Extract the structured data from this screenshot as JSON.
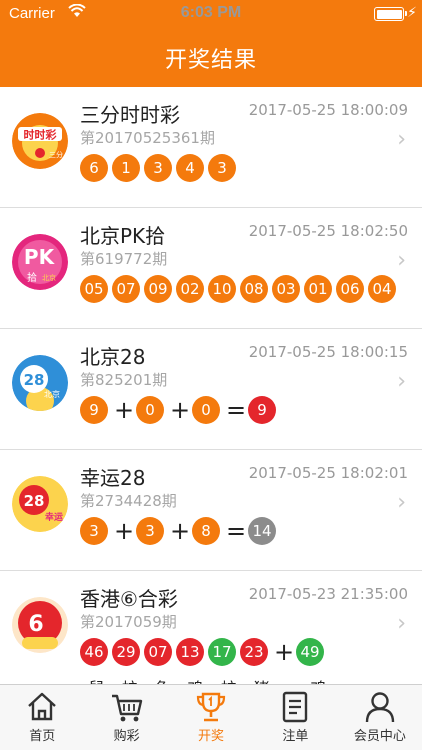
{
  "status_bar": {
    "carrier": "Carrier",
    "time": "6:03 PM"
  },
  "header": {
    "title": "开奖结果"
  },
  "lotteries": [
    {
      "name": "三分时时彩",
      "time": "2017-05-25 18:00:09",
      "issue": "第20170525361期",
      "numbers": [
        "6",
        "1",
        "3",
        "4",
        "3"
      ],
      "icon": "three-minute-lottery-logo"
    },
    {
      "name": "北京PK拾",
      "time": "2017-05-25 18:02:50",
      "issue": "第619772期",
      "numbers": [
        "05",
        "07",
        "09",
        "02",
        "10",
        "08",
        "03",
        "01",
        "06",
        "04"
      ],
      "icon": "beijing-pk10-logo"
    },
    {
      "name": "北京28",
      "time": "2017-05-25 18:00:15",
      "issue": "第825201期",
      "numbers": [
        "9",
        "0",
        "0"
      ],
      "sum": "9",
      "icon": "beijing-28-logo"
    },
    {
      "name": "幸运28",
      "time": "2017-05-25 18:02:01",
      "issue": "第2734428期",
      "numbers": [
        "3",
        "3",
        "8"
      ],
      "sum": "14",
      "icon": "lucky-28-logo"
    },
    {
      "name": "香港⑥合彩",
      "time": "2017-05-23 21:35:00",
      "issue": "第2017059期",
      "numbers": [
        "46",
        "29",
        "07",
        "13",
        "17",
        "23"
      ],
      "special": "49",
      "zodiacs": [
        "鼠",
        "蛇",
        "兔",
        "鸡",
        "蛇",
        "猪"
      ],
      "special_zodiac": "鸡",
      "icon": "hongkong-mark-six-logo"
    }
  ],
  "operators": {
    "plus": "+",
    "equals": "="
  },
  "tabbar": [
    {
      "label": "首页",
      "icon": "home-icon"
    },
    {
      "label": "购彩",
      "icon": "cart-icon"
    },
    {
      "label": "开奖",
      "icon": "trophy-icon"
    },
    {
      "label": "注单",
      "icon": "document-icon"
    },
    {
      "label": "会员中心",
      "icon": "user-icon"
    }
  ],
  "colors": {
    "accent": "#f47a0d",
    "red": "#e4262c",
    "green": "#33b54a",
    "gray": "#8c8c8c"
  }
}
